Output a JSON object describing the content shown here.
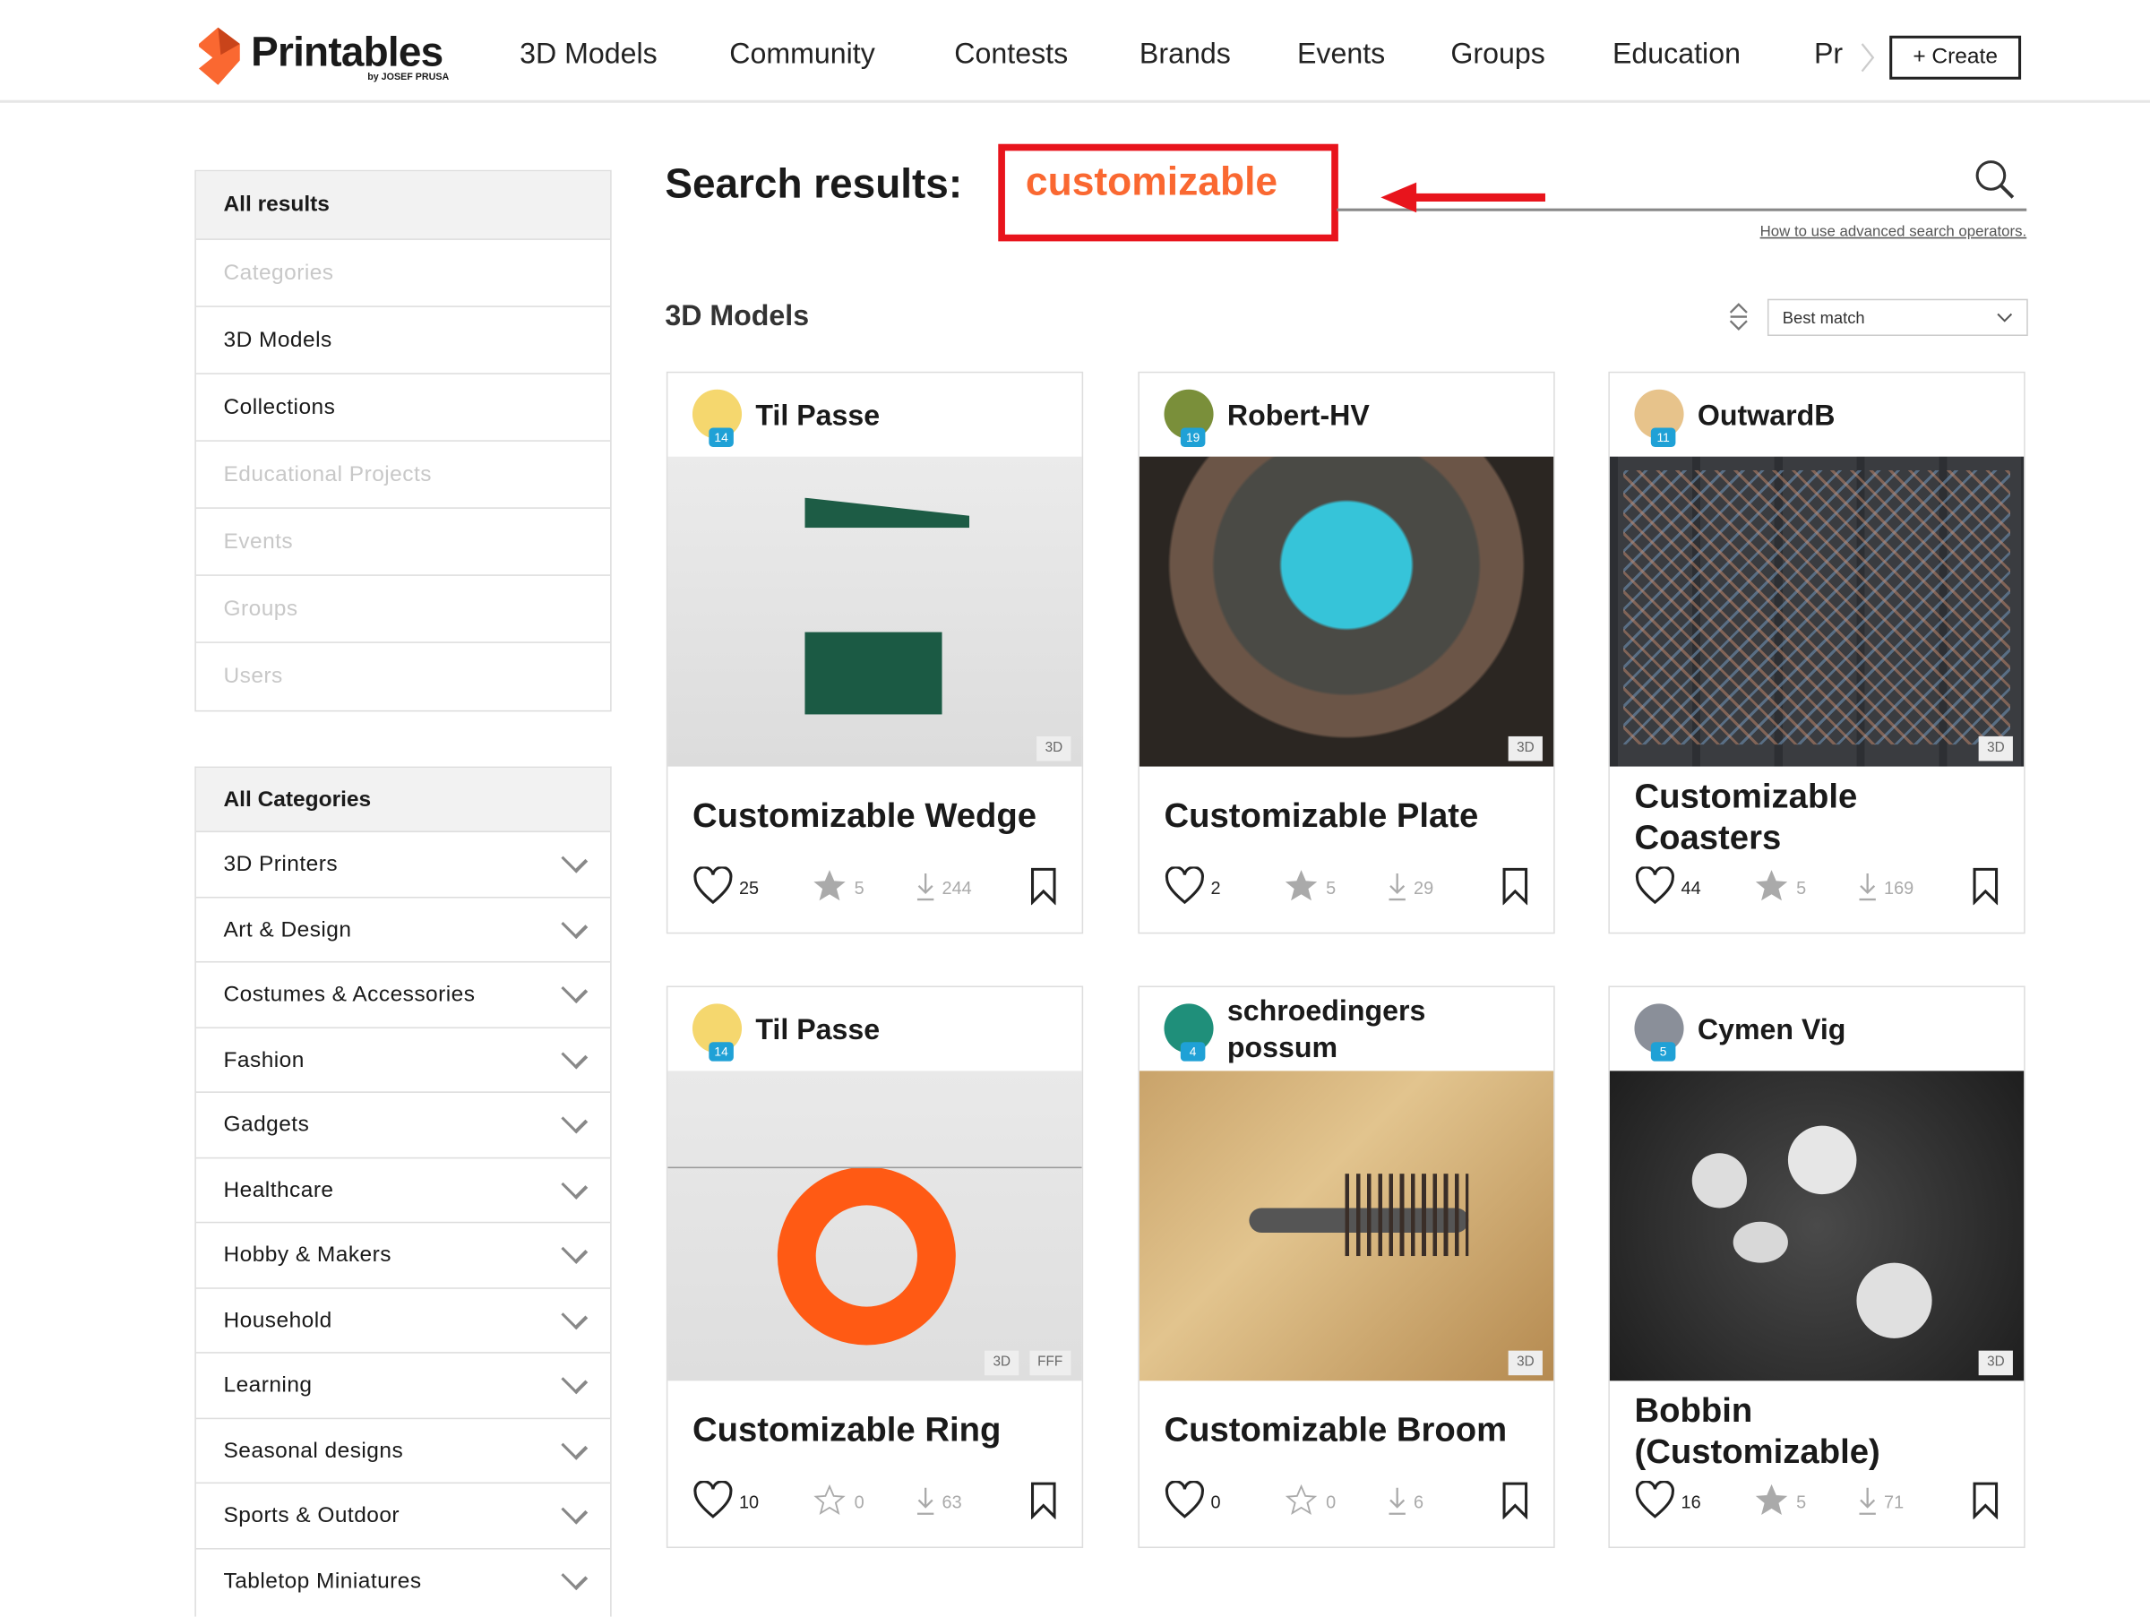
{
  "header": {
    "logo": "Printables",
    "logo_sub": "by JOSEF PRUSA",
    "nav": [
      "3D Models",
      "Community",
      "Contests",
      "Brands",
      "Events",
      "Groups",
      "Education",
      "Pr"
    ],
    "create_label": "+ Create"
  },
  "sidebar": {
    "results_header": "All results",
    "results_items": [
      {
        "label": "Categories",
        "enabled": false
      },
      {
        "label": "3D Models",
        "enabled": true
      },
      {
        "label": "Collections",
        "enabled": true
      },
      {
        "label": "Educational Projects",
        "enabled": false
      },
      {
        "label": "Events",
        "enabled": false
      },
      {
        "label": "Groups",
        "enabled": false
      },
      {
        "label": "Users",
        "enabled": false
      }
    ],
    "categories_header": "All Categories",
    "categories": [
      "3D Printers",
      "Art & Design",
      "Costumes & Accessories",
      "Fashion",
      "Gadgets",
      "Healthcare",
      "Hobby & Makers",
      "Household",
      "Learning",
      "Seasonal designs",
      "Sports & Outdoor",
      "Tabletop Miniatures"
    ]
  },
  "search": {
    "label": "Search results:",
    "query": "customizable",
    "help_link": "How to use advanced search operators."
  },
  "section": {
    "title": "3D Models",
    "sort": "Best match"
  },
  "colors": {
    "accent": "#fa6831",
    "highlight": "#e8141c"
  },
  "cards": [
    {
      "user": "Til Passe",
      "level": "14",
      "title": "Customizable Wedge",
      "likes": "25",
      "rating": "5",
      "downloads": "244",
      "tags": [
        "3D"
      ],
      "rated": true
    },
    {
      "user": "Robert-HV",
      "level": "19",
      "title": "Customizable Plate",
      "likes": "2",
      "rating": "5",
      "downloads": "29",
      "tags": [
        "3D"
      ],
      "rated": true
    },
    {
      "user": "OutwardB",
      "level": "11",
      "title": "Customizable Coasters",
      "likes": "44",
      "rating": "5",
      "downloads": "169",
      "tags": [
        "3D"
      ],
      "rated": true
    },
    {
      "user": "Til Passe",
      "level": "14",
      "title": "Customizable Ring",
      "likes": "10",
      "rating": "0",
      "downloads": "63",
      "tags": [
        "3D",
        "FFF"
      ],
      "rated": false
    },
    {
      "user": "schroedingers possum",
      "level": "4",
      "title": "Customizable Broom",
      "likes": "0",
      "rating": "0",
      "downloads": "6",
      "tags": [
        "3D"
      ],
      "rated": false
    },
    {
      "user": "Cymen Vig",
      "level": "5",
      "title": "Bobbin (Customizable)",
      "likes": "16",
      "rating": "5",
      "downloads": "71",
      "tags": [
        "3D"
      ],
      "rated": true
    }
  ]
}
